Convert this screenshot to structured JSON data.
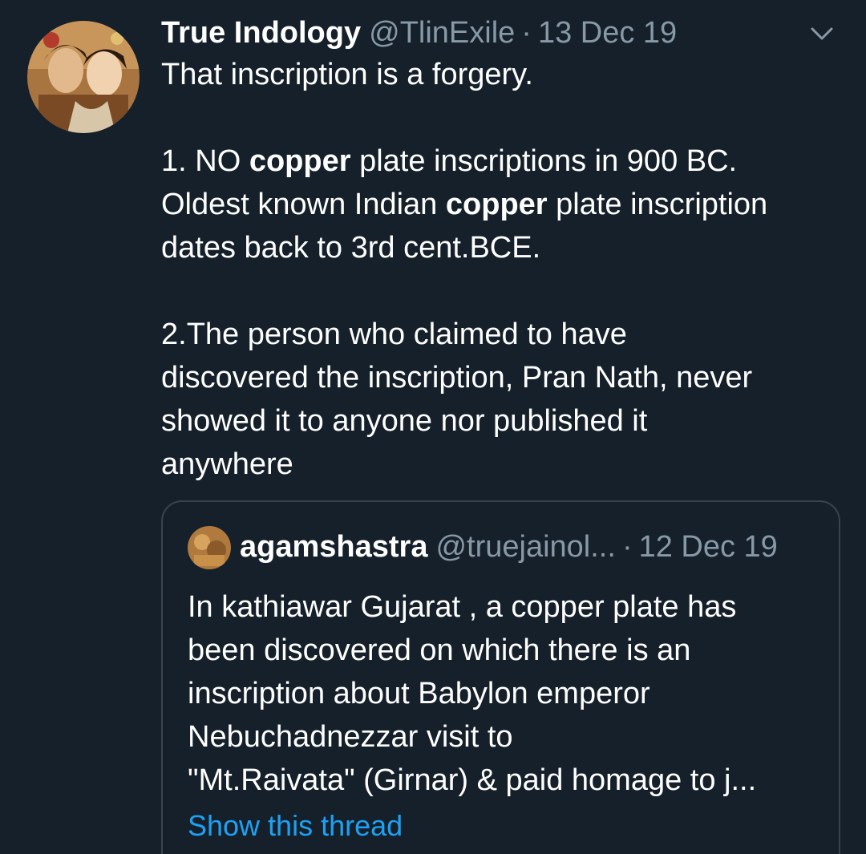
{
  "tweet": {
    "author_name": "True Indology",
    "author_handle": "@TlinExile",
    "separator": "·",
    "date": "13 Dec 19",
    "lines": [
      "That inscription is a forgery."
    ],
    "point1": {
      "prefix": "1. NO ",
      "bold1": "copper",
      "mid1": " plate inscriptions in 900 BC.",
      "line2_prefix": "Oldest known Indian ",
      "bold2": "copper",
      "line2_suffix": " plate inscription",
      "line3": "dates back to 3rd cent.BCE."
    },
    "point2": {
      "line1": "2.The person who claimed to have",
      "line2": "discovered the inscription, Pran Nath, never",
      "line3": "showed it to anyone nor published it",
      "line4": "anywhere"
    },
    "menu_icon": "chevron-down-icon"
  },
  "quoted_tweet": {
    "author_name": "agamshastra",
    "author_handle": "@truejainol...",
    "separator": "·",
    "date": "12 Dec 19",
    "lines": [
      "In kathiawar Gujarat , a copper plate has",
      "been discovered on which there is an",
      "inscription about Babylon emperor",
      "Nebuchadnezzar visit to",
      "\"Mt.Raivata\" (Girnar) & paid homage to j..."
    ],
    "show_thread": "Show this thread"
  },
  "colors": {
    "background": "#15202b",
    "secondary_text": "#8899a6",
    "link": "#1da1f2",
    "border": "#38444d"
  }
}
